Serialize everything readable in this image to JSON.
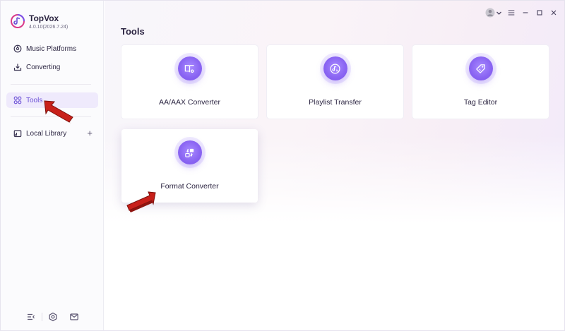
{
  "app": {
    "name": "TopVox",
    "version": "4.0.10(2026.7.24)"
  },
  "sidebar": {
    "items": [
      {
        "label": "Music Platforms",
        "icon": "music-disc-icon"
      },
      {
        "label": "Converting",
        "icon": "download-tray-icon"
      },
      {
        "label": "Tools",
        "icon": "grid-icon",
        "active": true
      },
      {
        "label": "Local Library",
        "icon": "folder-icon"
      }
    ],
    "bottom_icons": [
      "menu-collapse-icon",
      "settings-icon",
      "mail-icon"
    ]
  },
  "main": {
    "title": "Tools",
    "tools": [
      {
        "label": "AA/AAX Converter",
        "icon": "book-icon"
      },
      {
        "label": "Playlist Transfer",
        "icon": "music-note-icon"
      },
      {
        "label": "Tag Editor",
        "icon": "tag-icon"
      },
      {
        "label": "Format Converter",
        "icon": "convert-icon"
      }
    ]
  },
  "window_controls": [
    "user-avatar-icon",
    "chevron-down-icon",
    "hamburger-menu-icon",
    "minimize-icon",
    "maximize-icon",
    "close-icon"
  ],
  "colors": {
    "accent": "#8b66f3",
    "active_bg": "#efeafc",
    "arrow": "#c8201a"
  }
}
